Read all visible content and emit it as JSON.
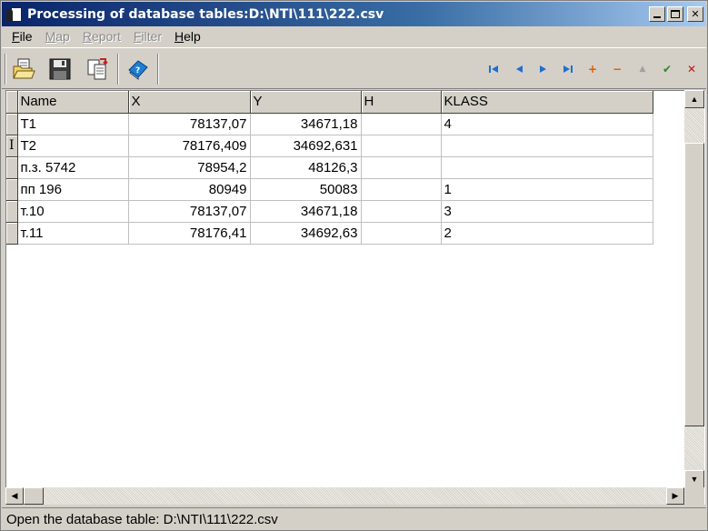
{
  "window": {
    "title": "Processing of database tables:D:\\NTI\\111\\222.csv",
    "controls": {
      "minimize": "_",
      "maximize": "□",
      "close": "✕"
    }
  },
  "menu": {
    "items": [
      {
        "label": "File",
        "enabled": true
      },
      {
        "label": "Map",
        "enabled": false
      },
      {
        "label": "Report",
        "enabled": false
      },
      {
        "label": "Filter",
        "enabled": false
      },
      {
        "label": "Help",
        "enabled": true
      }
    ]
  },
  "toolbar": {
    "buttons": [
      "open-folder-icon",
      "save-disk-icon",
      "copy-document-icon",
      "help-book-icon"
    ],
    "navigator": {
      "first": "|◀",
      "prior": "◀",
      "next": "▶",
      "last": "▶|",
      "insert": "+",
      "delete": "−",
      "edit": "▲",
      "post": "✔",
      "cancel": "✕",
      "colors": {
        "nav": "#1f6fd1",
        "insert": "#e05a00",
        "delete": "#e05a00",
        "edit": "#a0a0a0",
        "post": "#2a8a2a",
        "cancel": "#d01010"
      }
    }
  },
  "grid": {
    "columns": [
      "Name",
      "X",
      "Y",
      "H",
      "KLASS"
    ],
    "active_row_indicator": "I",
    "active_row": 1,
    "rows": [
      {
        "name": "T1",
        "x": "78137,07",
        "y": "34671,18",
        "h": "",
        "klass": "4"
      },
      {
        "name": "T2",
        "x": "78176,409",
        "y": "34692,631",
        "h": "",
        "klass": ""
      },
      {
        "name": "п.з. 5742",
        "x": "78954,2",
        "y": "48126,3",
        "h": "",
        "klass": ""
      },
      {
        "name": "пп 196",
        "x": "80949",
        "y": "50083",
        "h": "",
        "klass": "1"
      },
      {
        "name": "т.10",
        "x": "78137,07",
        "y": "34671,18",
        "h": "",
        "klass": "3"
      },
      {
        "name": "т.11",
        "x": "78176,41",
        "y": "34692,63",
        "h": "",
        "klass": "2"
      }
    ]
  },
  "status": {
    "text": "Open the database table:  D:\\NTI\\111\\222.csv"
  }
}
